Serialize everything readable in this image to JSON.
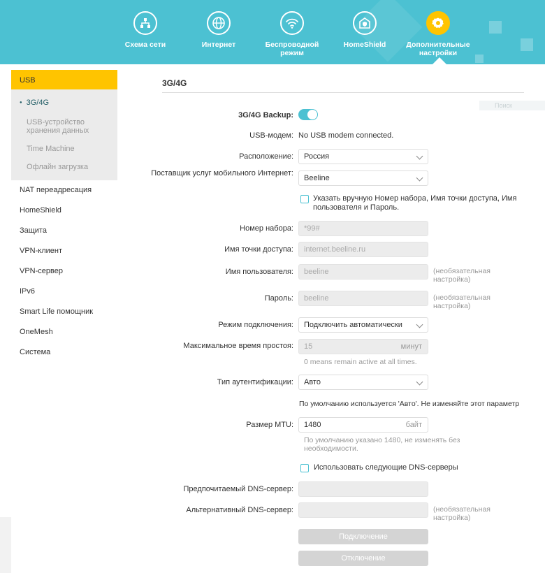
{
  "nav": {
    "items": [
      {
        "label": "Схема сети",
        "icon": "network-map-icon"
      },
      {
        "label": "Интернет",
        "icon": "globe-icon"
      },
      {
        "label": "Беспроводной режим",
        "icon": "wifi-icon"
      },
      {
        "label": "HomeShield",
        "icon": "shield-house-icon"
      },
      {
        "label": "Дополнительные настройки",
        "icon": "gear-icon"
      }
    ],
    "active_index": 4,
    "accent_color": "#4cc1d2",
    "active_color": "#ffc400"
  },
  "sidebar": {
    "section": "USB",
    "sub_items": [
      "3G/4G",
      "USB-устройство хранения данных",
      "Time Machine",
      "Офлайн загрузка"
    ],
    "items": [
      "NAT переадресация",
      "HomeShield",
      "Защита",
      "VPN-клиент",
      "VPN-сервер",
      "IPv6",
      "Smart Life помощник",
      "OneMesh",
      "Система"
    ]
  },
  "page": {
    "title": "3G/4G",
    "ghost_text": "Поиск",
    "backup_label": "3G/4G Backup:",
    "backup_on": true,
    "modem_label": "USB-модем:",
    "modem_value": "No USB modem connected.",
    "location_label": "Расположение:",
    "location_value": "Россия",
    "isp_label": "Поставщик услуг мобильного Интернет:",
    "isp_value": "Beeline",
    "manual_checkbox_label": "Указать вручную Номер набора, Имя точки доступа, Имя пользователя и Пароль.",
    "dial_label": "Номер набора:",
    "dial_value": "*99#",
    "apn_label": "Имя точки доступа:",
    "apn_value": "internet.beeline.ru",
    "user_label": "Имя пользователя:",
    "user_value": "beeline",
    "optional_hint": "(необязательная настройка)",
    "password_label": "Пароль:",
    "password_value": "beeline",
    "conn_mode_label": "Режим подключения:",
    "conn_mode_value": "Подключить автоматически",
    "idle_label": "Максимальное время простоя:",
    "idle_value": "15",
    "idle_unit": "минут",
    "idle_hint": "0 means remain active at all times.",
    "auth_label": "Тип аутентификации:",
    "auth_value": "Авто",
    "auth_note": "По умолчанию используется 'Авто'. Не изменяйте этот параметр",
    "mtu_label": "Размер MTU:",
    "mtu_value": "1480",
    "mtu_unit": "байт",
    "mtu_hint": "По умолчанию указано 1480, не изменять без необходимости.",
    "dns_checkbox_label": "Использовать следующие DNS-серверы",
    "dns1_label": "Предпочитаемый DNS-сервер:",
    "dns2_label": "Альтернативный DNS-сервер:",
    "dns_optional_hint": "(необязательная настройка)",
    "connect_button": "Подключение",
    "disconnect_button": "Отключение"
  }
}
